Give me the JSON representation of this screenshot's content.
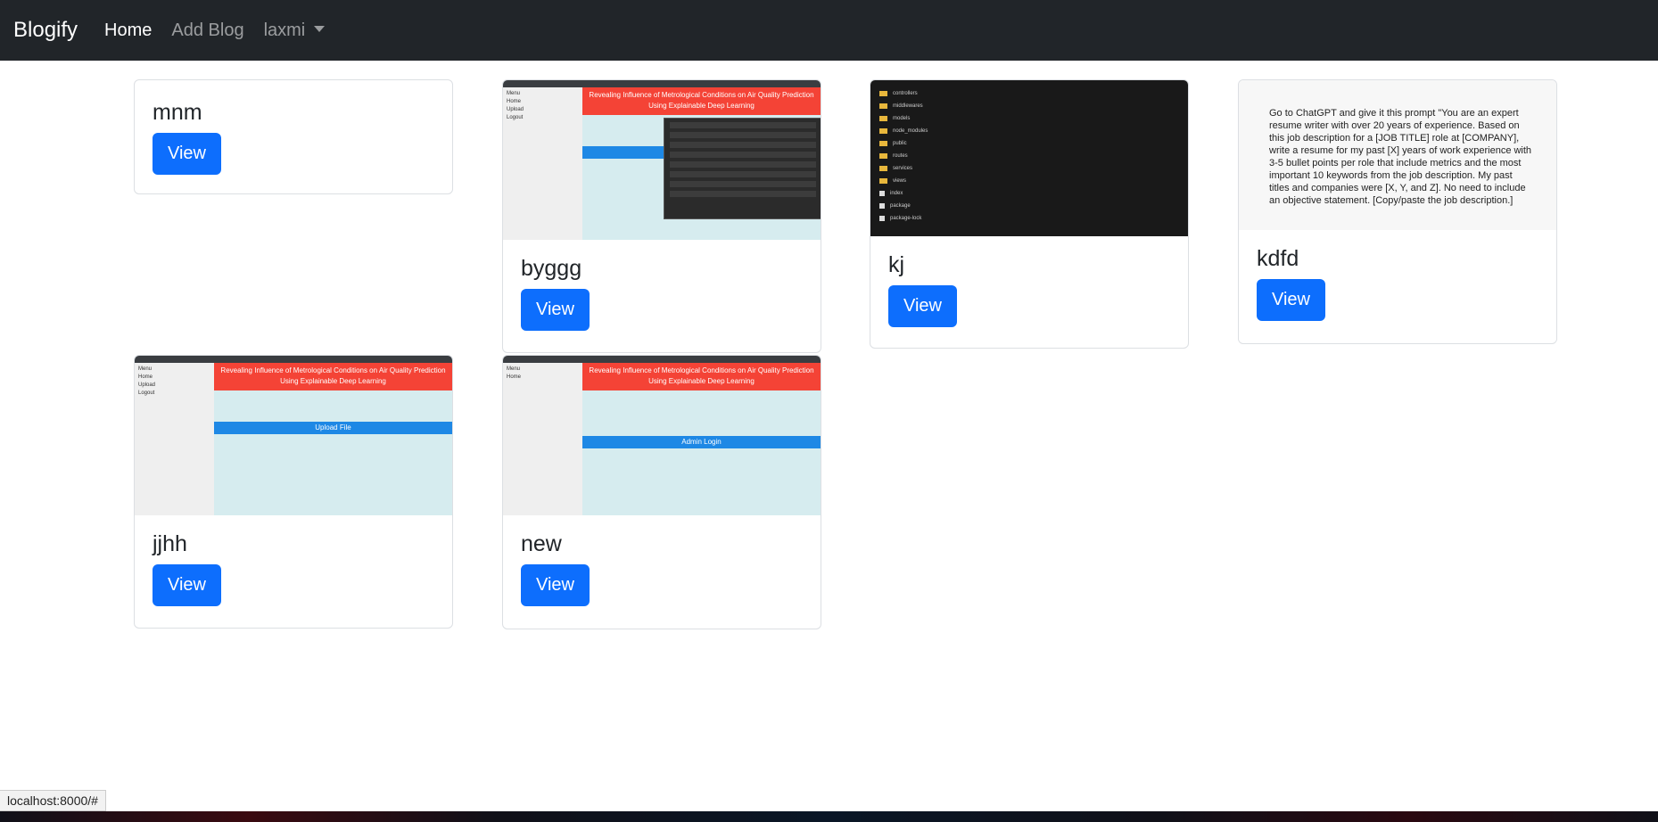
{
  "navbar": {
    "brand": "Blogify",
    "links": [
      "Home",
      "Add Blog"
    ],
    "user_menu": "laxmi"
  },
  "cards": [
    {
      "title": "mnm",
      "button": "View",
      "thumbnail": "none"
    },
    {
      "title": "byggg",
      "button": "View",
      "thumbnail": "air-quality-upload-dialog"
    },
    {
      "title": "kj",
      "button": "View",
      "thumbnail": "file-explorer"
    },
    {
      "title": "kdfd",
      "button": "View",
      "thumbnail": "text"
    },
    {
      "title": "jjhh",
      "button": "View",
      "thumbnail": "air-quality-upload"
    },
    {
      "title": "new",
      "button": "View",
      "thumbnail": "air-quality-admin-login"
    }
  ],
  "thumbnails": {
    "aq_menu": [
      "Menu",
      "Home",
      "Upload",
      "Logout"
    ],
    "aq_banner": "Revealing Influence of Metrological Conditions on Air Quality Prediction Using Explainable Deep Learning",
    "upload_bar": "Upload File",
    "login_bar": "Admin Login",
    "explorer_rows": [
      "controllers",
      "middlewares",
      "models",
      "node_modules",
      "public",
      "routes",
      "services",
      "views",
      "index",
      "package",
      "package-lock"
    ],
    "prompt_text": "Go to ChatGPT and give it this prompt \"You are an expert resume writer with over 20 years of experience. Based on this job description for a [JOB TITLE] role at [COMPANY], write a resume for my past [X] years of work experience with 3-5 bullet points per role that include metrics and the most important 10 keywords from the job description. My past titles and companies were [X, Y, and Z]. No need to include an objective statement. [Copy/paste the job description.]"
  },
  "status_bar": "localhost:8000/#",
  "colors": {
    "primary": "#0d6efd",
    "navbar": "#212529",
    "banner": "#f44336"
  }
}
